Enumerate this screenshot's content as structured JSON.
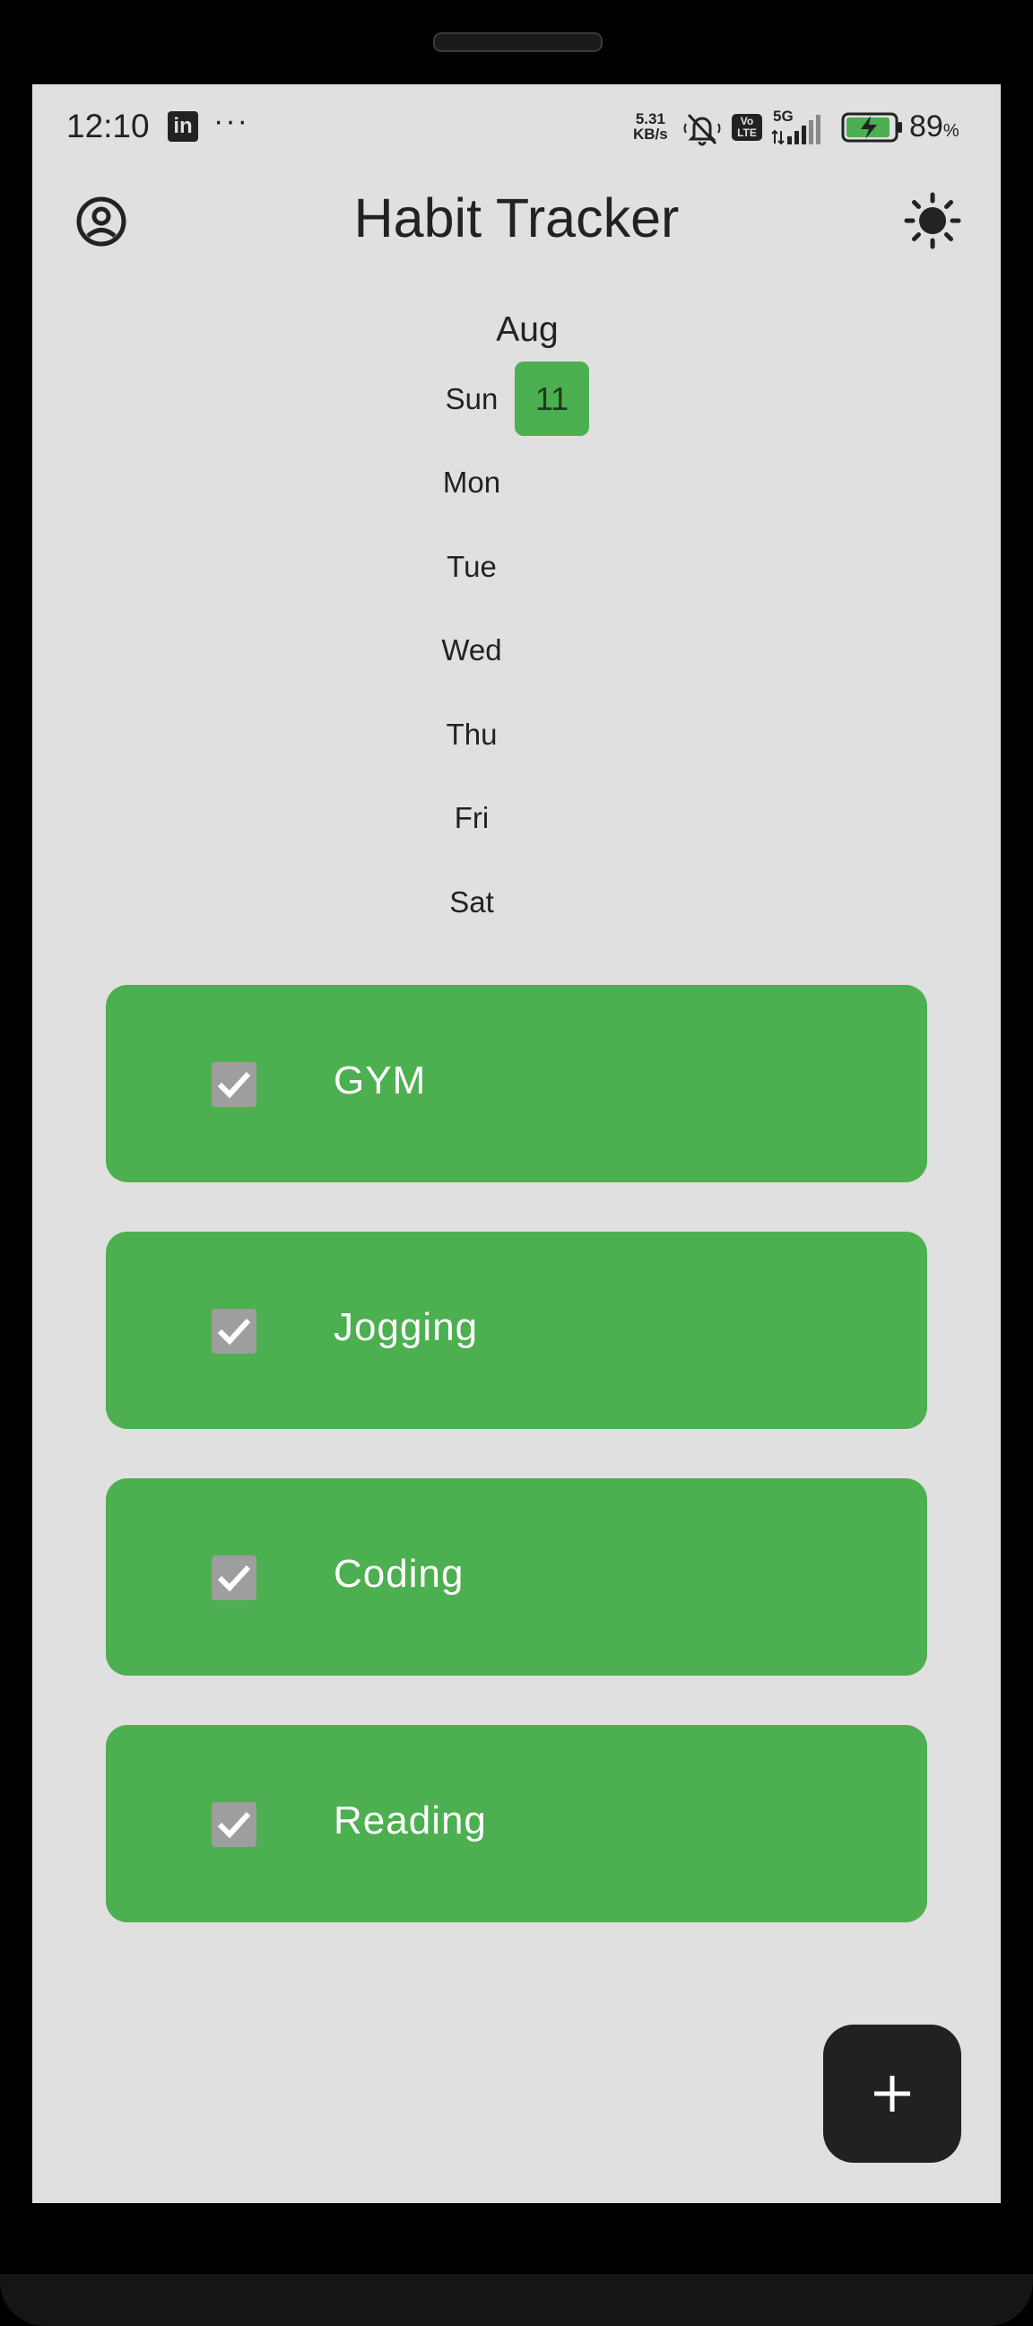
{
  "status_bar": {
    "time": "12:10",
    "dots": "···",
    "net_speed_value": "5.31",
    "net_speed_unit": "KB/s",
    "signal_label": "5G",
    "volte_label": "Vo LTE",
    "battery_percent": "89",
    "battery_symbol": "%",
    "icons": [
      "linkedin-icon",
      "silent-icon",
      "volte-icon",
      "signal-icon",
      "battery-charging-icon"
    ]
  },
  "app_bar": {
    "title": "Habit Tracker",
    "left_icon": "profile-icon",
    "right_icon": "light-mode-icon"
  },
  "calendar": {
    "month": "Aug",
    "days": [
      "Sun",
      "Mon",
      "Tue",
      "Wed",
      "Thu",
      "Fri",
      "Sat"
    ],
    "highlighted_date": "11",
    "highlight_color": "#4caf50"
  },
  "habits": [
    {
      "name": "GYM",
      "checked": true
    },
    {
      "name": "Jogging",
      "checked": true
    },
    {
      "name": "Coding",
      "checked": true
    },
    {
      "name": "Reading",
      "checked": true
    }
  ],
  "fab": {
    "label": "+",
    "icon": "add-icon"
  },
  "colors": {
    "background": "#e0e0e0",
    "card": "#4caf50",
    "checkbox": "#9e9e9e",
    "fab": "#212121",
    "text": "#222222"
  }
}
